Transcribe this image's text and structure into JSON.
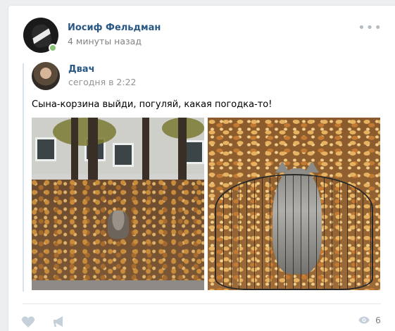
{
  "post": {
    "author": "Иосиф Фельдман",
    "time": "4 минуты назад",
    "more_icon": "ellipsis-icon"
  },
  "repost": {
    "author": "Двач",
    "time": "сегодня в 2:22",
    "text": "Сына-корзина выйди, погуляй, какая погодка-то!"
  },
  "actions": {
    "views": "6"
  },
  "colors": {
    "link": "#2a5885",
    "muted": "#828282",
    "online": "#8ac176"
  }
}
